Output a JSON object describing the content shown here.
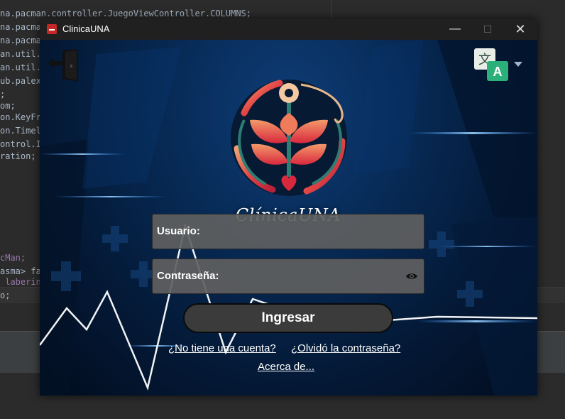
{
  "ide": {
    "lines": [
      "na.pacman.controller.JuegoViewController.COLUMNS;",
      "na.pacman",
      "na.pacma",
      "an.util.",
      "an.util.",
      "ub.palex",
      ";",
      "om;",
      "on.KeyFr",
      "on.Timel",
      "ontrol.I",
      "ration;",
      "cMan;",
      "asma> fa",
      " laberin",
      "o;"
    ]
  },
  "window": {
    "title": "ClinicaUNA",
    "minimize": "—",
    "maximize": "☐",
    "close": "✕"
  },
  "brand": {
    "name": "ClínicaUNA"
  },
  "form": {
    "user_label": "Usuario:",
    "password_label": "Contraseña:",
    "login_button": "Ingresar"
  },
  "links": {
    "signup": "¿No tiene una cuenta?",
    "forgot": "¿Olvidó la contraseña?",
    "about": "Acerca de..."
  },
  "icons": {
    "exit": "exit-door-icon",
    "translate": "translate-icon",
    "dropdown": "chevron-down-icon",
    "eye": "eye-icon",
    "logo": "flower-heart-logo"
  },
  "colors": {
    "accent_red": "#e53935",
    "accent_teal": "#2e7d74",
    "background_blue": "#072a55"
  }
}
